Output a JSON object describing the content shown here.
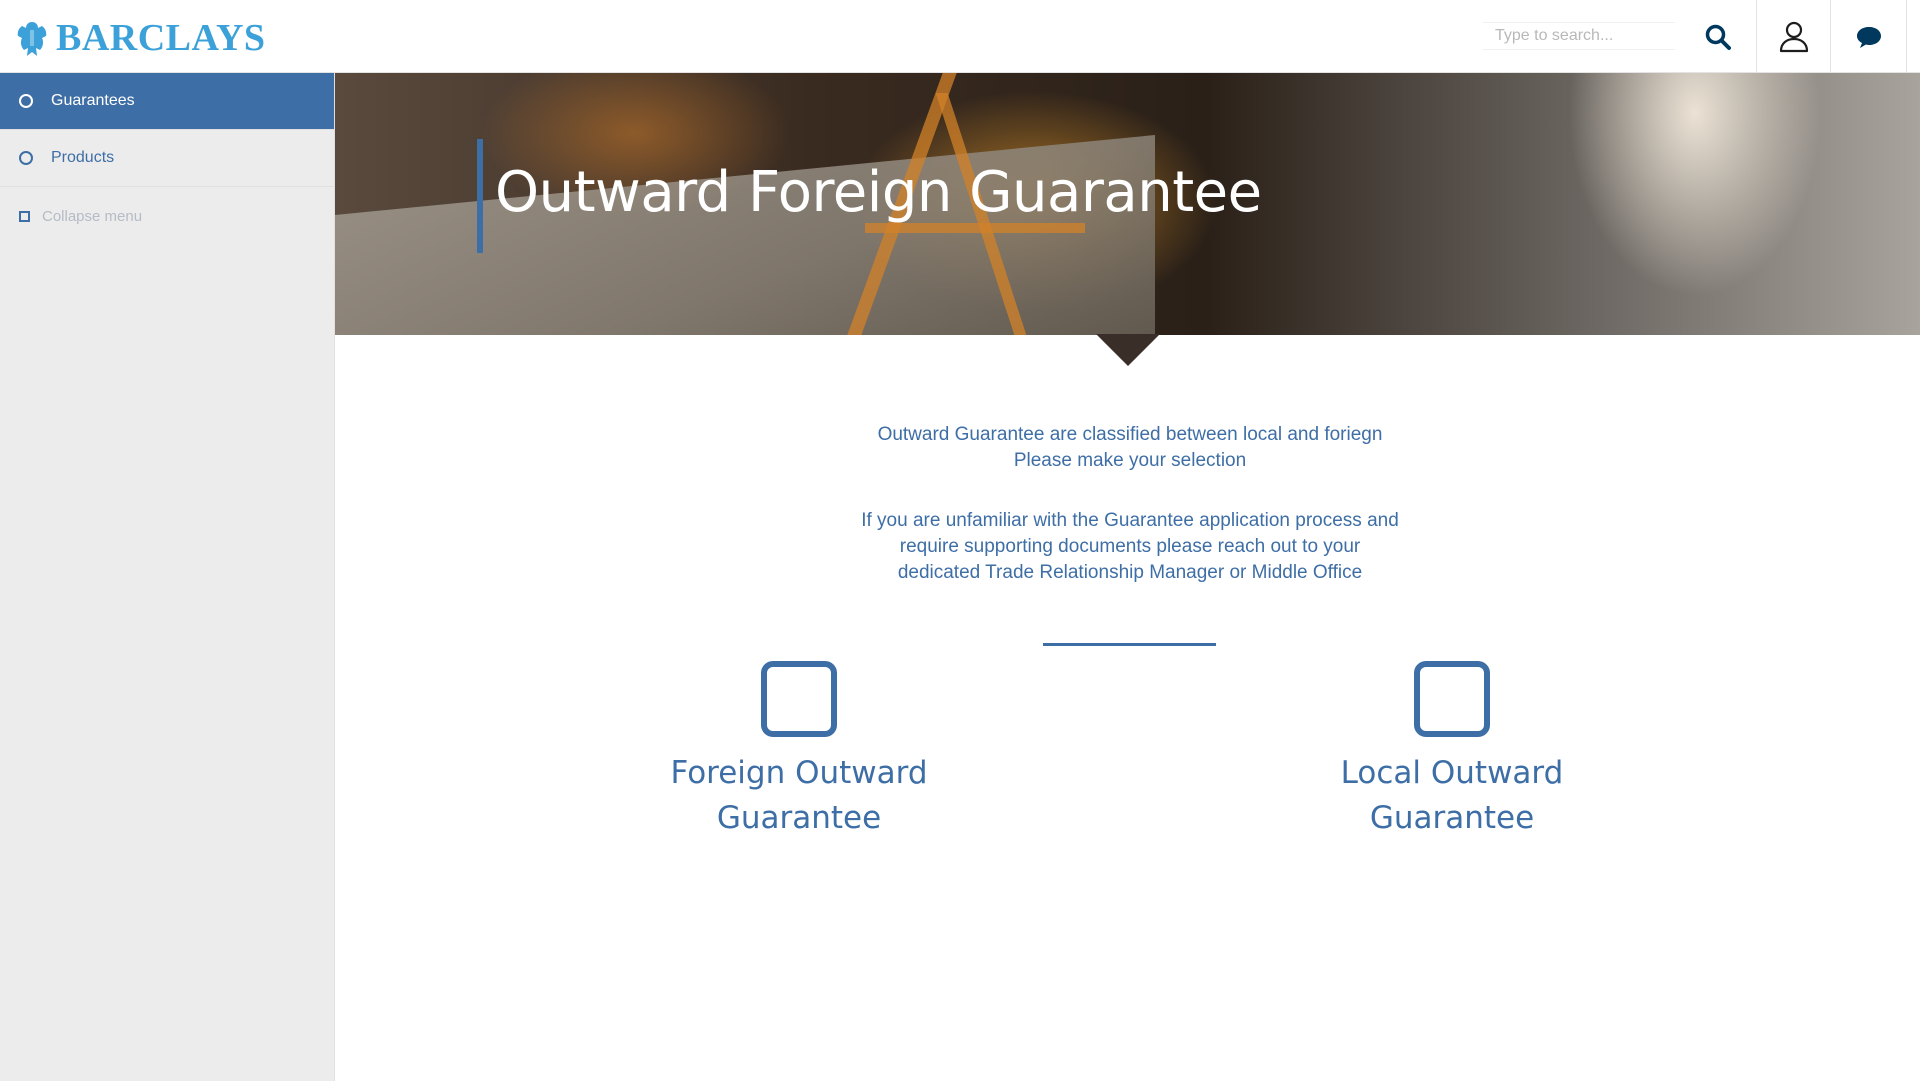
{
  "brand": {
    "name": "BARCLAYS",
    "logo_icon": "eagle-icon",
    "color": "#3ba1d8"
  },
  "header": {
    "search": {
      "placeholder": "Type to search...",
      "value": ""
    },
    "icons": [
      "search-icon",
      "user-icon",
      "chat-icon"
    ]
  },
  "sidebar": {
    "items": [
      {
        "label": "Guarantees",
        "active": true
      },
      {
        "label": "Products",
        "active": false
      }
    ],
    "collapse_label": "Collapse menu"
  },
  "hero": {
    "title": "Outward Foreign Guarantee"
  },
  "intro": {
    "line1": "Outward Guarantee are classified between local and foriegn",
    "line2": "Please make your selection",
    "para2_line1": "If you are unfamiliar with the Guarantee application process and",
    "para2_line2": "require supporting documents please reach out to your",
    "para2_line3": "dedicated Trade Relationship Manager or Middle Office"
  },
  "options": [
    {
      "line1": "Foreign Outward",
      "line2": "Guarantee",
      "checked": false
    },
    {
      "line1": "Local Outward",
      "line2": "Guarantee",
      "checked": false
    }
  ],
  "colors": {
    "accent": "#3e6ea6",
    "sidebar_bg": "#ececec"
  }
}
